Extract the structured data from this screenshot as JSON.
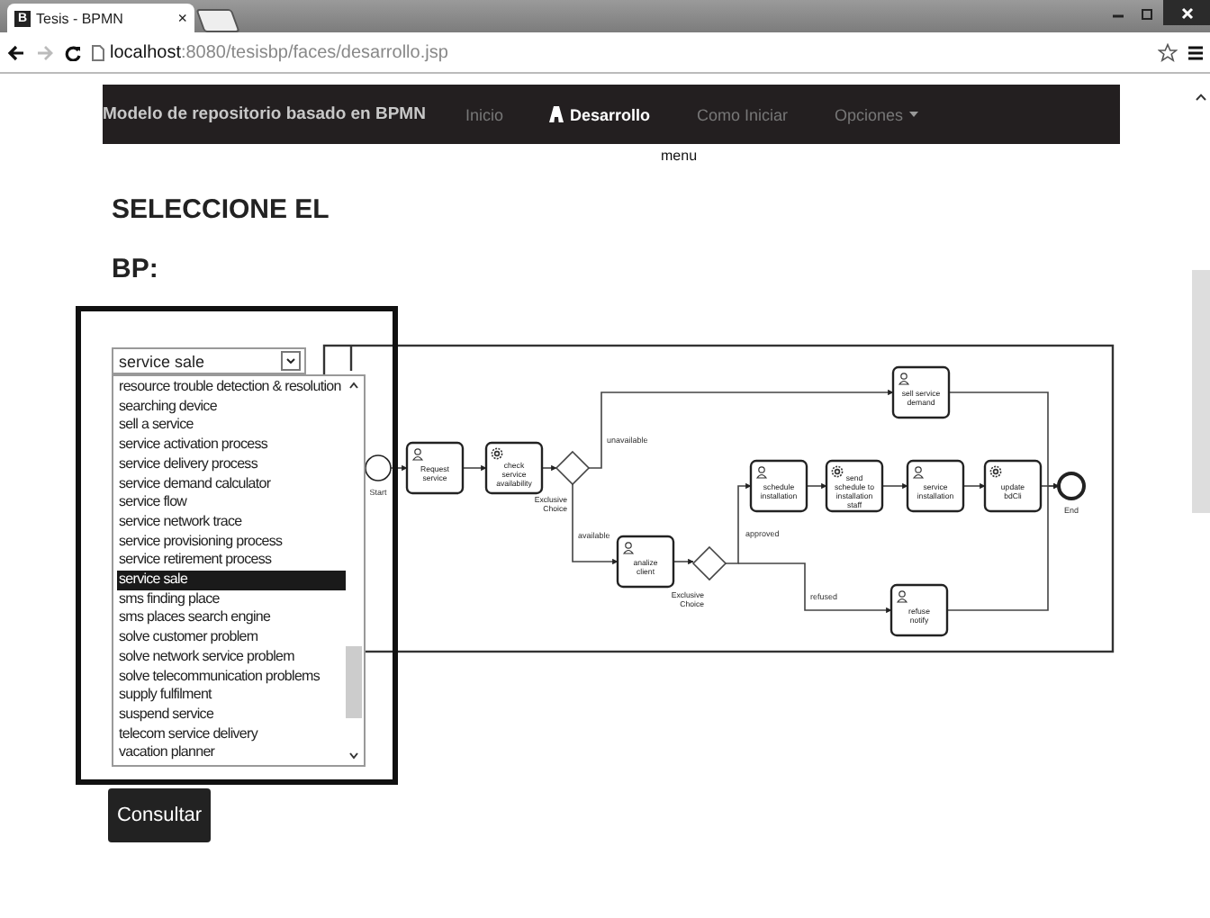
{
  "browser": {
    "tab": {
      "favicon": "B",
      "title": "Tesis - BPMN",
      "close": "×"
    },
    "address": {
      "host": "localhost",
      "path": ":8080/tesisbp/faces/desarrollo.jsp"
    }
  },
  "navbar": {
    "brand": "Modelo de repositorio basado en BPMN",
    "items": [
      {
        "label": "Inicio",
        "selected": false,
        "kind": "link"
      },
      {
        "label": "Desarrollo",
        "selected": true,
        "kind": "link"
      },
      {
        "label": "Como Iniciar",
        "selected": false,
        "kind": "link"
      },
      {
        "label": "Opciones",
        "selected": false,
        "kind": "dropdown"
      }
    ]
  },
  "menu_label": "menu",
  "heading": [
    "SELECCIONE EL",
    "BP:"
  ],
  "select": {
    "value": "service sale",
    "options": [
      {
        "label": "resource trouble detection & resolution",
        "selected": false
      },
      {
        "label": "searching device",
        "selected": false
      },
      {
        "label": "sell a service",
        "selected": false
      },
      {
        "label": "service activation process",
        "selected": false
      },
      {
        "label": "service delivery process",
        "selected": false
      },
      {
        "label": "service demand calculator",
        "selected": false
      },
      {
        "label": "service flow",
        "selected": false
      },
      {
        "label": "service network trace",
        "selected": false
      },
      {
        "label": "service provisioning process",
        "selected": false
      },
      {
        "label": "service retirement process",
        "selected": false
      },
      {
        "label": "service sale",
        "selected": true
      },
      {
        "label": "sms finding place",
        "selected": false
      },
      {
        "label": "sms places search engine",
        "selected": false
      },
      {
        "label": "solve customer problem",
        "selected": false
      },
      {
        "label": "solve network service problem",
        "selected": false
      },
      {
        "label": "solve telecommunication problems",
        "selected": false
      },
      {
        "label": "supply fulfilment",
        "selected": false
      },
      {
        "label": "suspend service",
        "selected": false
      },
      {
        "label": "telecom service delivery",
        "selected": false
      },
      {
        "label": "vacation planner",
        "selected": false
      }
    ]
  },
  "diagram": {
    "nodes": [
      {
        "kind": "start",
        "label": "Start"
      },
      {
        "kind": "user_task",
        "label": "Request service"
      },
      {
        "kind": "service_task",
        "label": "check service availability"
      },
      {
        "kind": "gateway",
        "label": "Exclusive Choice"
      },
      {
        "kind": "user_task",
        "label": "sell service demand"
      },
      {
        "kind": "user_task",
        "label": "analize client"
      },
      {
        "kind": "gateway",
        "label": "Exclusive Choice"
      },
      {
        "kind": "user_task",
        "label": "schedule installation"
      },
      {
        "kind": "service_task",
        "label": "send schedule to installation staff"
      },
      {
        "kind": "user_task",
        "label": "service installation"
      },
      {
        "kind": "service_task",
        "label": "update bdCli"
      },
      {
        "kind": "user_task",
        "label": "refuse notify"
      },
      {
        "kind": "end",
        "label": "End"
      }
    ],
    "edge_labels": [
      "unavailable",
      "available",
      "approved",
      "refused"
    ]
  },
  "button": "Consultar"
}
